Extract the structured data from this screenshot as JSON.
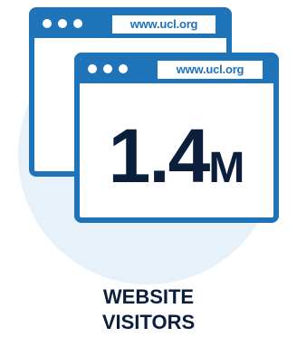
{
  "colors": {
    "primary_blue": "#1f73b8",
    "light_circle": "#e6f1f9",
    "dark_text": "#0b1f3d",
    "background": "#ffffff"
  },
  "back_window": {
    "url": "www.ucl.org",
    "icons": [
      "dot-icon",
      "dot-icon",
      "dot-icon"
    ]
  },
  "front_window": {
    "url": "www.ucl.org",
    "icons": [
      "dot-icon",
      "dot-icon",
      "dot-icon"
    ],
    "value": "1.4",
    "unit": "M"
  },
  "caption": {
    "line1": "WEBSITE",
    "line2": "VISITORS"
  }
}
